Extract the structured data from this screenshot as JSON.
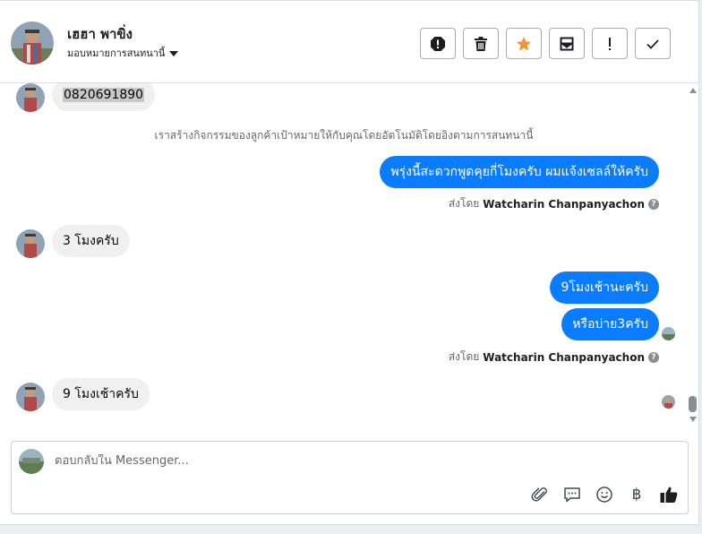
{
  "header": {
    "contact_name": "เฮฮา พาขิ่ง",
    "assign_label": "มอบหมายการสนทนานี้"
  },
  "actions": [
    {
      "name": "report-spam-button",
      "icon": "alert-octagon-icon"
    },
    {
      "name": "delete-button",
      "icon": "trash-icon"
    },
    {
      "name": "star-button",
      "icon": "star-icon",
      "color": "#f5922f"
    },
    {
      "name": "mark-unread-button",
      "icon": "envelope-icon"
    },
    {
      "name": "follow-up-button",
      "icon": "exclamation-icon"
    },
    {
      "name": "mark-done-button",
      "icon": "checkmark-icon"
    }
  ],
  "thread": {
    "msg_phone": "0820691890",
    "system_note": "เราสร้างกิจกรรมของลูกค้าเป้าหมายให้กับคุณโดยอัตโนมัติโดยอิงตามการสนทนานี้",
    "msg_out_1": "พรุ่งนี้สะดวกพูดคุยกี่โมงครับ ผมแจ้งเซลล์ให้ครับ",
    "sent_by_prefix": "ส่งโดย",
    "sent_by_name": "Watcharin Chanpanyachon",
    "msg_in_2": "3 โมงครับ",
    "msg_out_2": "9โมงเช้านะครับ",
    "msg_out_3": "หรือบ่าย3ครับ",
    "msg_in_3": "9 โมงเช้าครับ"
  },
  "composer": {
    "placeholder": "ตอบกลับใน Messenger...",
    "tools": [
      "paperclip-icon",
      "speech-bubble-icon",
      "emoji-icon",
      "baht-icon",
      "thumbs-up-icon"
    ],
    "baht_symbol": "฿"
  },
  "colors": {
    "outgoing_bubble": "#0a7cff",
    "incoming_bubble": "#f0f0f0",
    "star": "#f5922f"
  }
}
